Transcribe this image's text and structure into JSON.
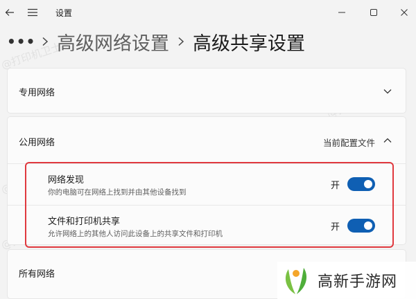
{
  "window": {
    "title": "设置",
    "accent": "#0f5fb3",
    "highlight_color": "#e0383e"
  },
  "breadcrumb": {
    "more": "•••",
    "parent": "高级网络设置",
    "current": "高级共享设置"
  },
  "watermark_text": "@打印机卫士",
  "sections": {
    "private": {
      "title": "专用网络",
      "icon": "chevron-down-icon"
    },
    "public": {
      "title": "公用网络",
      "profile_label": "当前配置文件",
      "icon": "chevron-up-icon",
      "settings": [
        {
          "title": "网络发现",
          "description": "你的电脑可在网络上找到并由其他设备找到",
          "state_label": "开",
          "on": true
        },
        {
          "title": "文件和打印机共享",
          "description": "允许网络上的其他人访问此设备上的共享文件和打印机",
          "state_label": "开",
          "on": true
        }
      ]
    },
    "all": {
      "title": "所有网络"
    }
  },
  "logo": {
    "text": "高新手游网"
  }
}
